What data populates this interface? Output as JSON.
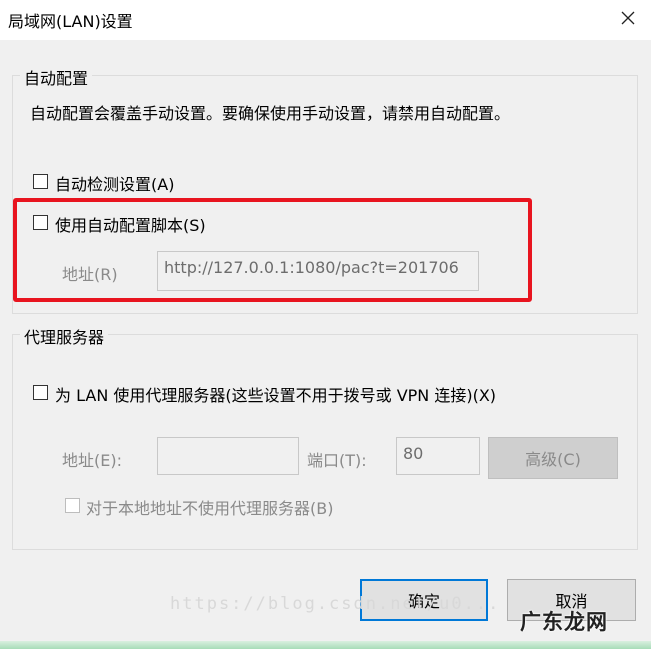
{
  "window": {
    "title": "局域网(LAN)设置"
  },
  "auto_config": {
    "group_label": "自动配置",
    "description": "自动配置会覆盖手动设置。要确保使用手动设置，请禁用自动配置。",
    "auto_detect_label": "自动检测设置(A)",
    "auto_detect_checked": false,
    "use_script_label": "使用自动配置脚本(S)",
    "use_script_checked": false,
    "address_label": "地址(R)",
    "address_value": "http://127.0.0.1:1080/pac?t=201706"
  },
  "proxy": {
    "group_label": "代理服务器",
    "use_proxy_label": "为 LAN 使用代理服务器(这些设置不用于拨号或 VPN 连接)(X)",
    "use_proxy_checked": false,
    "address_label": "地址(E):",
    "address_value": "",
    "port_label": "端口(T):",
    "port_value": "80",
    "advanced_label": "高级(C)",
    "bypass_label": "对于本地地址不使用代理服务器(B)",
    "bypass_checked": false
  },
  "footer": {
    "ok_label": "确定",
    "cancel_label": "取消"
  },
  "overlay": {
    "watermark": "https://blog.csdn.net/u0...",
    "brand": "广东龙网",
    "highlight_color": "#e8141f"
  }
}
